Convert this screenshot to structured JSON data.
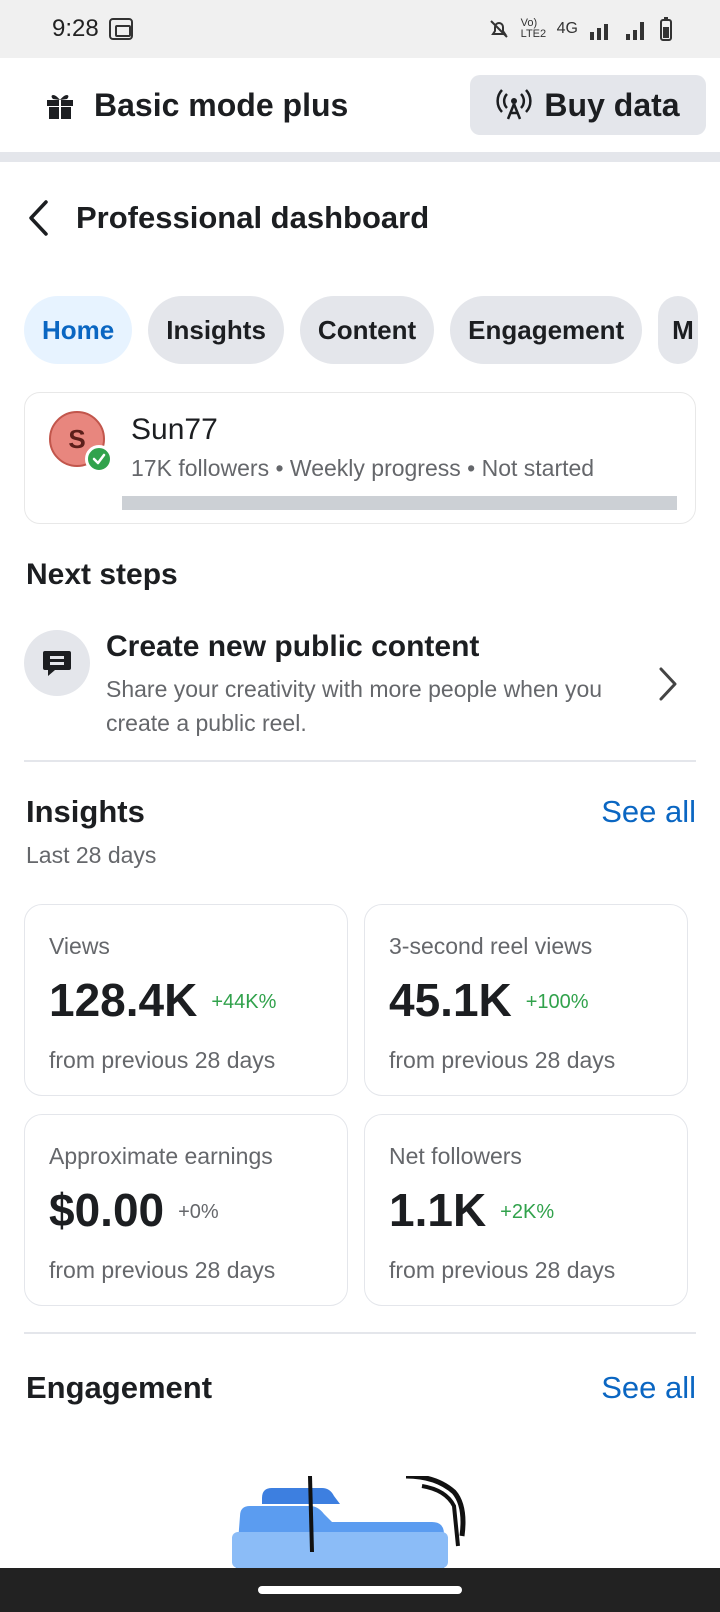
{
  "status_bar": {
    "time": "9:28",
    "volte_label": "Vo) LTE2",
    "network_label": "4G"
  },
  "top_bar": {
    "mode_label": "Basic mode plus",
    "buy_data_label": "Buy data"
  },
  "header": {
    "title": "Professional dashboard"
  },
  "tabs": [
    {
      "label": "Home",
      "active": true
    },
    {
      "label": "Insights",
      "active": false
    },
    {
      "label": "Content",
      "active": false
    },
    {
      "label": "Engagement",
      "active": false
    },
    {
      "label": "M",
      "active": false
    }
  ],
  "profile": {
    "avatar_letter": "S",
    "name": "Sun77",
    "meta": "17K followers • Weekly progress • Not started",
    "weekly_progress": 0
  },
  "next_steps": {
    "title": "Next steps",
    "item": {
      "title": "Create new public content",
      "description": "Share your creativity with more people when you create a public reel."
    }
  },
  "insights": {
    "title": "Insights",
    "see_all": "See all",
    "subtitle": "Last 28 days",
    "cards": [
      {
        "label": "Views",
        "value": "128.4K",
        "change": "+44K%",
        "foot": "from previous 28 days"
      },
      {
        "label": "3-second reel views",
        "value": "45.1K",
        "change": "+100%",
        "foot": "from previous 28 days"
      },
      {
        "label": "Approximate earnings",
        "value": "$0.00",
        "change": "+0%",
        "foot": "from previous 28 days"
      },
      {
        "label": "Net followers",
        "value": "1.1K",
        "change": "+2K%",
        "foot": "from previous 28 days"
      }
    ]
  },
  "engagement": {
    "title": "Engagement",
    "see_all": "See all"
  },
  "colors": {
    "accent": "#0a66c2",
    "positive": "#31a24c",
    "chip_bg": "#e4e6eb",
    "active_chip_bg": "#e7f3ff"
  },
  "icons": [
    "gift-icon",
    "broadcast-icon",
    "back-chevron-icon",
    "comment-icon",
    "chevron-right-icon",
    "verified-check-icon",
    "folder-illustration"
  ]
}
